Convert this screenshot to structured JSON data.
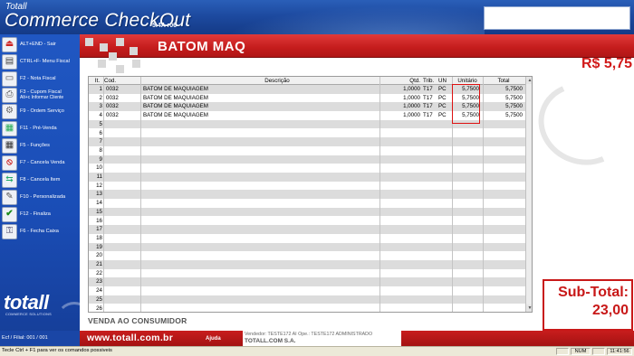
{
  "app": {
    "brand_small": "Totall",
    "brand_big": "Commerce CheckOut",
    "version": "5.4A r06"
  },
  "sidebar": {
    "items": [
      {
        "label": "ALT+END - Sair",
        "icon": "exit-icon"
      },
      {
        "label": "CTRL+F- Menu Fiscal",
        "icon": "fiscal-menu-icon"
      },
      {
        "label": "F2 - Nota Fiscal",
        "icon": "invoice-icon"
      },
      {
        "label": "F3 - Cupom Fiscal",
        "sub": "Alt+c Informar Cliente",
        "icon": "receipt-icon"
      },
      {
        "label": "F9 - Ordem Serviço",
        "icon": "service-order-icon"
      },
      {
        "label": "F11 - Pré-Venda",
        "icon": "presale-icon"
      },
      {
        "label": "F5 - Funções",
        "icon": "calculator-icon"
      },
      {
        "label": "F7 - Cancela Venda",
        "icon": "cancel-sale-icon"
      },
      {
        "label": "F8 - Cancela Item",
        "icon": "cancel-item-icon"
      },
      {
        "label": "F10 - Personalizada",
        "icon": "tools-icon"
      },
      {
        "label": "F12 - Finaliza",
        "icon": "checkmark-icon"
      },
      {
        "label": "F6 - Fecha Caixa",
        "icon": "close-register-icon"
      }
    ],
    "logo": "totall",
    "logo_sub": "COMMERCE SOLUTIONS"
  },
  "title": "BATOM MAQ",
  "price_display": "R$  5,75",
  "table": {
    "headers": {
      "it": "It.",
      "cod": "Cod.",
      "desc": "Descrição",
      "qtd": "Qtd.",
      "trib": "Trib.",
      "un": "UN",
      "unit": "Unitário",
      "total": "Total"
    },
    "rows": [
      {
        "it": "1",
        "cod": "0032",
        "desc": "BATOM DE MAQUIAGEM",
        "qtd": "1,0000",
        "trib": "T17",
        "un": "PC",
        "unit": "5,7500",
        "total": "5,7500"
      },
      {
        "it": "2",
        "cod": "0032",
        "desc": "BATOM DE MAQUIAGEM",
        "qtd": "1,0000",
        "trib": "T17",
        "un": "PC",
        "unit": "5,7500",
        "total": "5,7500"
      },
      {
        "it": "3",
        "cod": "0032",
        "desc": "BATOM DE MAQUIAGEM",
        "qtd": "1,0000",
        "trib": "T17",
        "un": "PC",
        "unit": "5,7500",
        "total": "5,7500"
      },
      {
        "it": "4",
        "cod": "0032",
        "desc": "BATOM DE MAQUIAGEM",
        "qtd": "1,0000",
        "trib": "T17",
        "un": "PC",
        "unit": "5,7500",
        "total": "5,7500"
      },
      {
        "it": "5"
      },
      {
        "it": "6"
      },
      {
        "it": "7"
      },
      {
        "it": "8"
      },
      {
        "it": "9"
      },
      {
        "it": "10"
      },
      {
        "it": "11"
      },
      {
        "it": "12"
      },
      {
        "it": "13"
      },
      {
        "it": "14"
      },
      {
        "it": "15"
      },
      {
        "it": "16"
      },
      {
        "it": "17"
      },
      {
        "it": "18"
      },
      {
        "it": "19"
      },
      {
        "it": "20"
      },
      {
        "it": "21"
      },
      {
        "it": "22"
      },
      {
        "it": "23"
      },
      {
        "it": "24"
      },
      {
        "it": "25"
      },
      {
        "it": "26"
      }
    ]
  },
  "subtotal": {
    "label": "Sub-Total:",
    "value": "23,00"
  },
  "venda_label": "VENDA AO CONSUMIDOR",
  "footer": {
    "ecf_info": "Ecf / Filial:  001 / 001",
    "website": "www.totall.com.br",
    "ajuda": "Ajuda",
    "vendedor": "Vendedor: TESTE172 AI   Ope.: TESTE172 ADMINISTRADO",
    "company": "TOTALL.COM S.A."
  },
  "status_bar": {
    "text": "Tecle Ctrl + F1 para ver os comandos possiveis",
    "num": "NUM",
    "time": "11:41:56"
  },
  "colors": {
    "brand_blue": "#1d4aa0",
    "brand_red": "#c41c1c",
    "highlight_red": "#d11a1a"
  }
}
